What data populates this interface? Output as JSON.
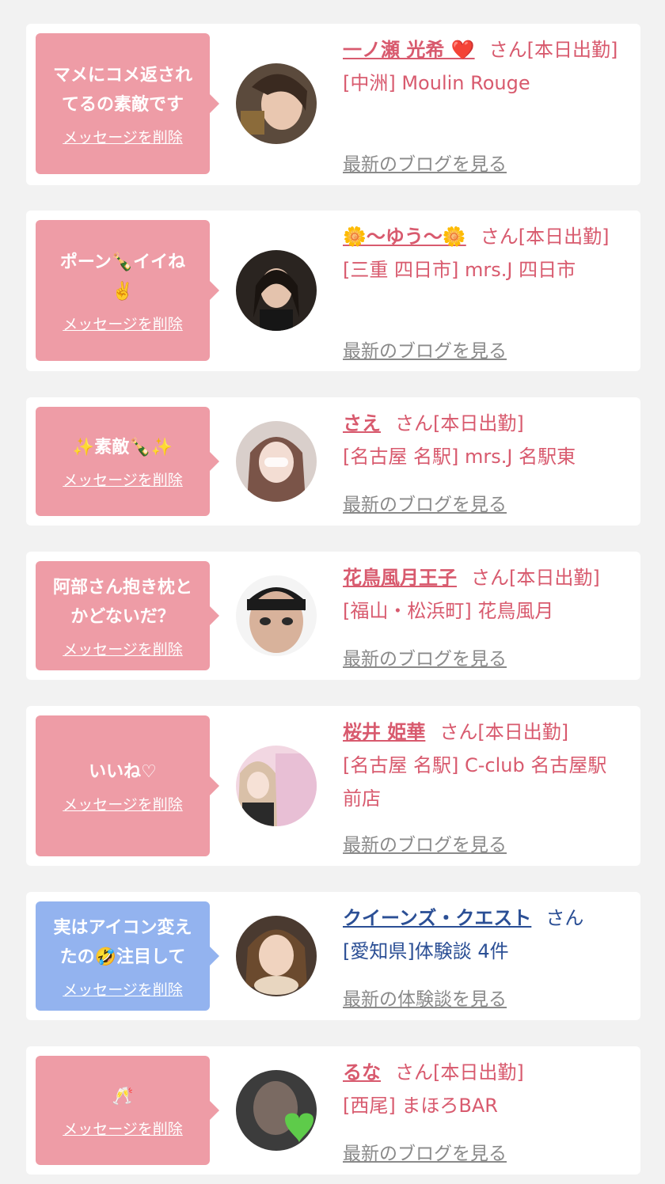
{
  "common": {
    "delete_label": "メッセージを削除",
    "blog_label": "最新のブログを見る",
    "review_label": "最新の体験談を見る"
  },
  "colors": {
    "bubble_pink": "#ee9ca6",
    "bubble_blue": "#93b3ef",
    "name_pink": "#d85a6e",
    "name_blue": "#2b4f95"
  },
  "cards": [
    {
      "message_lines": [
        "マメにコメ返され",
        "てるの素敵です"
      ],
      "name": "一ノ瀬 光希 ❤️",
      "suffix": "さん[本日出勤]",
      "location": "[中洲] Moulin Rouge"
    },
    {
      "message_lines": [
        "ポーン🍾イイね",
        "✌️"
      ],
      "name": "🌼〜ゆう〜🌼",
      "suffix": "さん[本日出勤]",
      "location": "[三重 四日市] mrs.J 四日市"
    },
    {
      "message_lines": [
        "✨素敵🍾✨"
      ],
      "name": "さえ",
      "suffix": "さん[本日出勤]",
      "location": "[名古屋 名駅] mrs.J 名駅東"
    },
    {
      "message_lines": [
        "阿部さん抱き枕と",
        "かどないだ？"
      ],
      "name": "花鳥風月王子",
      "suffix": "さん[本日出勤]",
      "location": "[福山・松浜町] 花鳥風月"
    },
    {
      "message_lines": [
        "いいね♡"
      ],
      "name": "桜井 姫華",
      "suffix": "さん[本日出勤]",
      "location": "[名古屋 名駅] C-club 名古屋駅前店"
    },
    {
      "message_lines": [
        "実はアイコン変え",
        "たの🤣注目して"
      ],
      "name": "クイーンズ・クエスト",
      "suffix": "さん",
      "location": "[愛知県]体験談 4件"
    },
    {
      "message_lines": [
        "🥂"
      ],
      "name": "るな",
      "suffix": "さん[本日出勤]",
      "location": "[西尾] まほろBAR"
    }
  ]
}
